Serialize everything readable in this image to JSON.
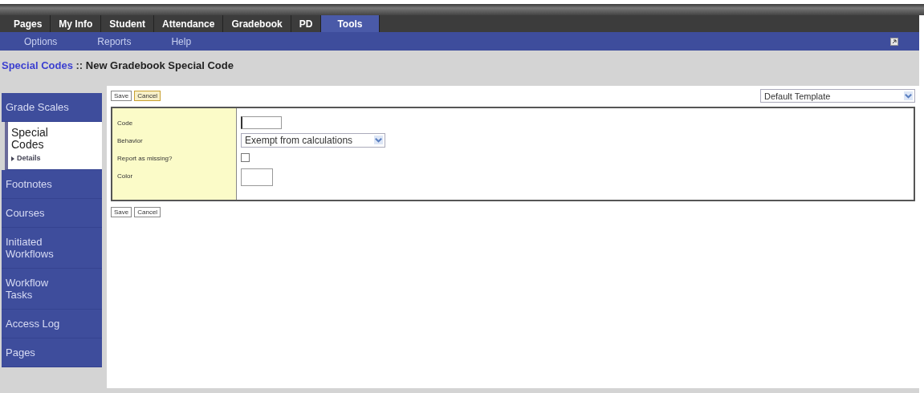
{
  "tabs": [
    {
      "label": "Pages",
      "selected": false
    },
    {
      "label": "My Info",
      "selected": false
    },
    {
      "label": "Student",
      "selected": false
    },
    {
      "label": "Attendance",
      "selected": false
    },
    {
      "label": "Gradebook",
      "selected": false
    },
    {
      "label": "PD",
      "selected": false
    },
    {
      "label": "Tools",
      "selected": true
    }
  ],
  "subnav": [
    "Options",
    "Reports",
    "Help"
  ],
  "breadcrumb": {
    "link": "Special Codes",
    "separator": " :: ",
    "title": "New Gradebook Special Code"
  },
  "sidebar": {
    "items": [
      {
        "label": "Grade Scales",
        "selected": false
      },
      {
        "label": "Special Codes",
        "selected": true,
        "children": [
          {
            "label": "Details"
          }
        ]
      },
      {
        "label": "Footnotes",
        "selected": false
      },
      {
        "label": "Courses",
        "selected": false
      },
      {
        "label": "Initiated Workflows",
        "selected": false
      },
      {
        "label": "Workflow Tasks",
        "selected": false
      },
      {
        "label": "Access Log",
        "selected": false
      },
      {
        "label": "Pages",
        "selected": false
      }
    ]
  },
  "top_buttons": [
    "Save",
    "Cancel"
  ],
  "template_select": {
    "value": "Default Template"
  },
  "form": {
    "fields": [
      {
        "label": "Code",
        "kind": "text"
      },
      {
        "label": "Behavior",
        "kind": "select",
        "value": "Exempt from calculations"
      },
      {
        "label": "Report as missing?",
        "kind": "checkbox",
        "checked": false
      },
      {
        "label": "Color",
        "kind": "color"
      }
    ]
  },
  "bottom_buttons": [
    "Save",
    "Cancel"
  ]
}
